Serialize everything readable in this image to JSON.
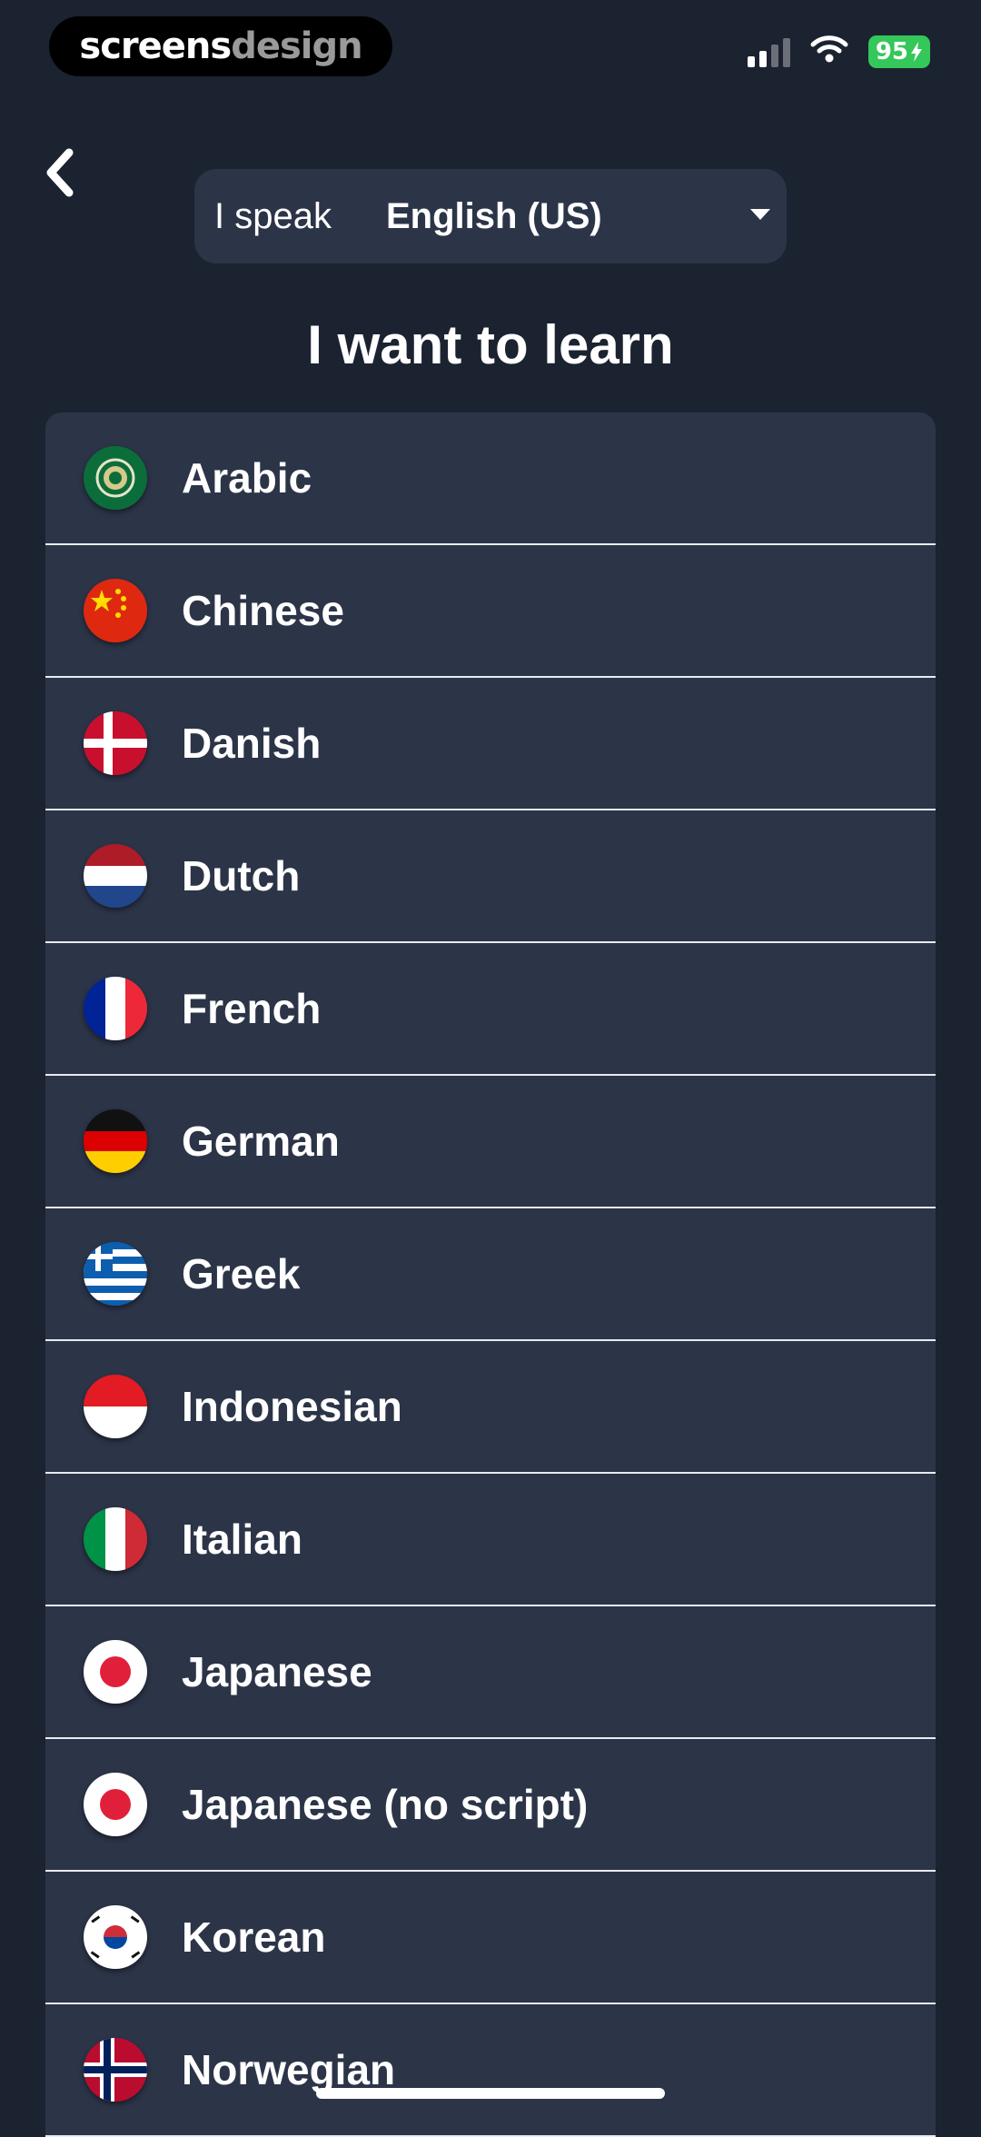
{
  "status_bar": {
    "brand_part1": "screens",
    "brand_part2": "design",
    "battery": "95",
    "icons": [
      "cellular-signal-icon",
      "wifi-icon",
      "battery-charging-icon"
    ],
    "battery_color": "#34c759"
  },
  "header": {
    "back_icon": "chevron-left-icon",
    "speak_label": "I speak",
    "speak_value": "English (US)",
    "dropdown_icon": "caret-down-icon"
  },
  "title": "I want to learn",
  "languages": [
    {
      "label": "Arabic",
      "icon": "arabic-flag-icon"
    },
    {
      "label": "Chinese",
      "icon": "china-flag-icon"
    },
    {
      "label": "Danish",
      "icon": "denmark-flag-icon"
    },
    {
      "label": "Dutch",
      "icon": "netherlands-flag-icon"
    },
    {
      "label": "French",
      "icon": "france-flag-icon"
    },
    {
      "label": "German",
      "icon": "germany-flag-icon"
    },
    {
      "label": "Greek",
      "icon": "greece-flag-icon"
    },
    {
      "label": "Indonesian",
      "icon": "indonesia-flag-icon"
    },
    {
      "label": "Italian",
      "icon": "italy-flag-icon"
    },
    {
      "label": "Japanese",
      "icon": "japan-flag-icon"
    },
    {
      "label": "Japanese (no script)",
      "icon": "japan-flag-icon"
    },
    {
      "label": "Korean",
      "icon": "korea-flag-icon"
    },
    {
      "label": "Norwegian",
      "icon": "norway-flag-icon"
    }
  ],
  "colors": {
    "background": "#1b2230",
    "card": "#2c3448",
    "divider": "#e9ebef",
    "text": "#ffffff"
  }
}
